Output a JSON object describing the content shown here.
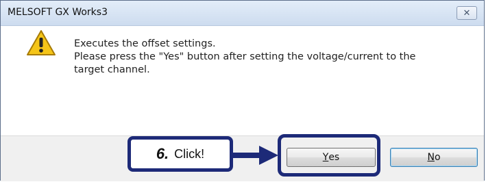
{
  "window": {
    "title": "MELSOFT GX Works3",
    "close_glyph": "✕"
  },
  "message": {
    "icon": "warning-icon",
    "lines": [
      "Executes the offset settings.",
      "Please press the \"Yes\" button after setting the voltage/current to the",
      "target channel."
    ]
  },
  "buttons": {
    "yes": {
      "prefix": "",
      "mnemonic": "Y",
      "rest": "es"
    },
    "no": {
      "prefix": "",
      "mnemonic": "N",
      "rest": "o"
    }
  },
  "annotation": {
    "step": "6.",
    "action": "Click!",
    "color": "#1d2a78"
  },
  "colors": {
    "titlebar": "#d6e3f3",
    "footer": "#f0f0f0",
    "warning": "#f5c518",
    "accent": "#1d2a78"
  }
}
